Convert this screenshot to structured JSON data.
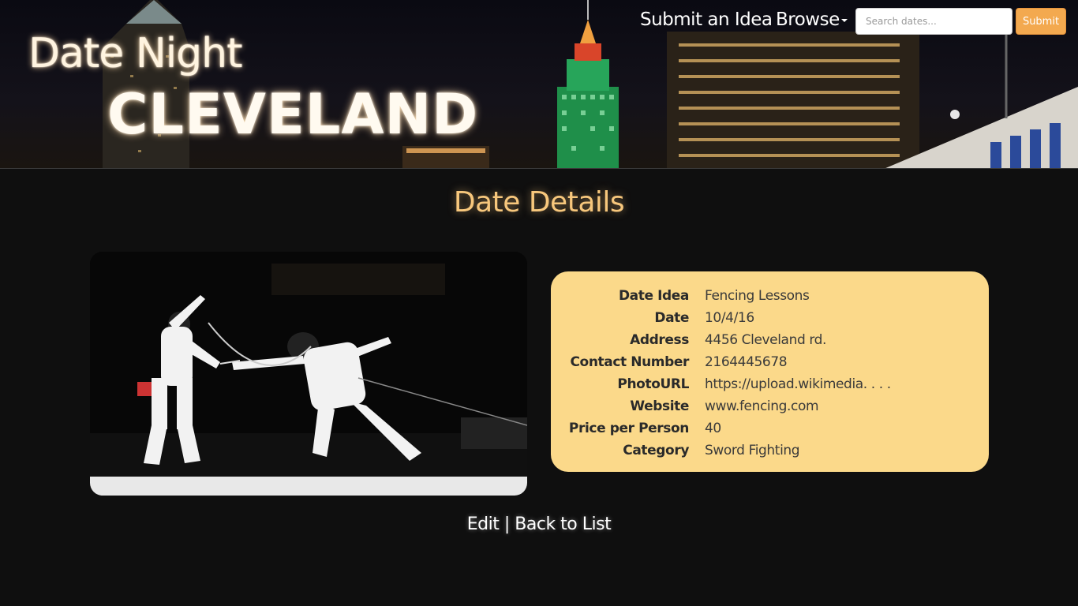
{
  "brand": {
    "line1": "Date Night",
    "line2": "CLEVELAND"
  },
  "nav": {
    "submit_idea": "Submit an Idea",
    "browse": "Browse",
    "search_placeholder": "Search dates...",
    "search_button": "Submit"
  },
  "page": {
    "title": "Date Details"
  },
  "details": [
    {
      "label": "Date Idea",
      "value": "Fencing Lessons"
    },
    {
      "label": "Date",
      "value": "10/4/16"
    },
    {
      "label": "Address",
      "value": "4456 Cleveland rd."
    },
    {
      "label": "Contact Number",
      "value": "2164445678"
    },
    {
      "label": "PhotoURL",
      "value": "https://upload.wikimedia. . . ."
    },
    {
      "label": "Website",
      "value": "www.fencing.com"
    },
    {
      "label": "Price per Person",
      "value": "40"
    },
    {
      "label": "Category",
      "value": "Sword Fighting"
    }
  ],
  "footer": {
    "edit": "Edit",
    "separator": "|",
    "back": "Back to List"
  },
  "colors": {
    "accent": "#f7c77c",
    "card": "#fbd98a",
    "button": "#f3a94f",
    "background": "#0f0f0f"
  }
}
